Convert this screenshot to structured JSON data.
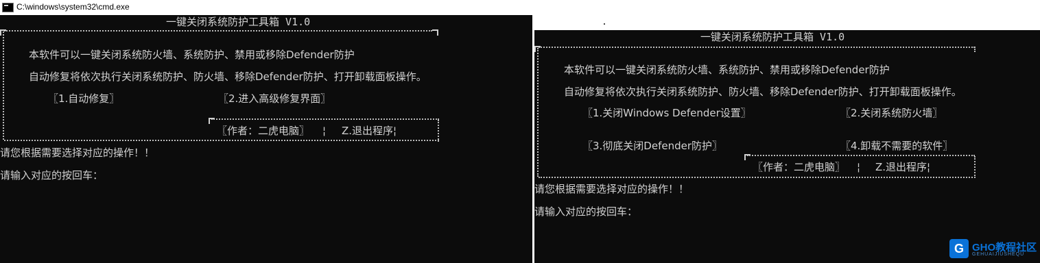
{
  "window": {
    "title": "C:\\windows\\system32\\cmd.exe"
  },
  "left": {
    "heading": "一键关闭系统防护工具箱 V1.0",
    "desc1": "本软件可以一键关闭系统防火墙、系统防护、禁用或移除Defender防护",
    "desc2": "自动修复将依次执行关闭系统防护、防火墙、移除Defender防护、打开卸载面板操作。",
    "options": [
      "〖1.自动修复〗",
      "〖2.进入高级修复界面〗"
    ],
    "footer": {
      "author": "〖作者：二虎电脑〗",
      "sep": "¦",
      "exit": "Z.退出程序¦"
    },
    "prompt1": "请您根据需要选择对应的操作！！",
    "prompt2": "请输入对应的按回车："
  },
  "right": {
    "heading": "一键关闭系统防护工具箱 V1.0",
    "desc1": "本软件可以一键关闭系统防火墙、系统防护、禁用或移除Defender防护",
    "desc2": "自动修复将依次执行关闭系统防护、防火墙、移除Defender防护、打开卸载面板操作。",
    "options": [
      "〖1.关闭Windows Defender设置〗",
      "〖2.关闭系统防火墙〗",
      "〖3.彻底关闭Defender防护〗",
      "〖4.卸载不需要的软件〗"
    ],
    "footer": {
      "author": "〖作者：二虎电脑〗",
      "sep": "¦",
      "exit": "Z.退出程序¦"
    },
    "prompt1": "请您根据需要选择对应的操作！！",
    "prompt2": "请输入对应的按回车："
  },
  "watermark": {
    "logo": "G",
    "text": "GHO教程社区",
    "sub": "GEHUAIJIUSHEQU"
  }
}
